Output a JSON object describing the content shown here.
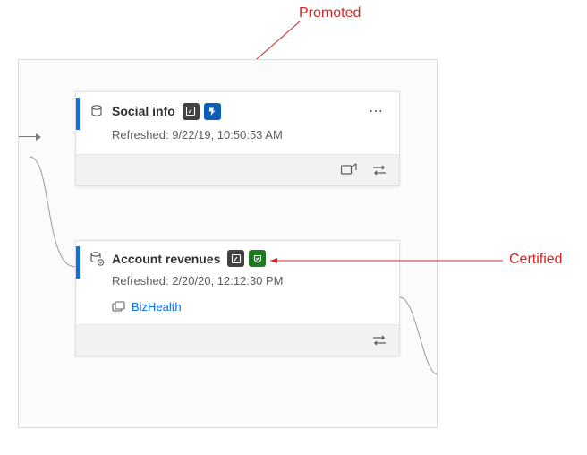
{
  "annotations": {
    "promoted_label": "Promoted",
    "certified_label": "Certified"
  },
  "card1": {
    "title": "Social info",
    "refreshed_label": "Refreshed: 9/22/19, 10:50:53 AM"
  },
  "card2": {
    "title": "Account revenues",
    "refreshed_label": "Refreshed: 2/20/20, 12:12:30 PM",
    "workspace_link": "BizHealth"
  },
  "icons": {
    "database": "database-icon",
    "dataset_linked": "dataset-linked-icon",
    "sensitivity": "sensitivity-icon",
    "promoted": "promoted-icon",
    "certified": "certified-icon",
    "workspace": "workspace-icon",
    "share": "share-out-icon",
    "swap": "swap-icon",
    "more": "⋯"
  }
}
